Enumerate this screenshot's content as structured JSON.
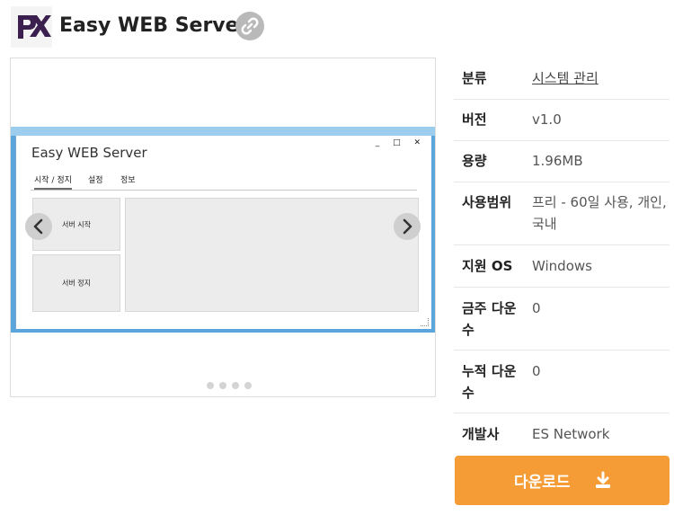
{
  "app": {
    "title": "Easy WEB Server",
    "logo_icon": "px-logo-icon",
    "link_icon": "link-icon",
    "brand_color": "#3b1f4e"
  },
  "carousel": {
    "screenshot": {
      "window_title": "Easy WEB Server",
      "window_controls": "_ □ ✕",
      "tabs": [
        {
          "label": "시작 / 정지",
          "active": true
        },
        {
          "label": "설정",
          "active": false
        },
        {
          "label": "정보",
          "active": false
        }
      ],
      "buttons": {
        "start": "서버 시작",
        "stop": "서버 정지"
      }
    },
    "prev_icon": "chevron-left-icon",
    "next_icon": "chevron-right-icon",
    "page_count": 4
  },
  "info": {
    "category": {
      "label": "분류",
      "value": "시스템 관리"
    },
    "version": {
      "label": "버전",
      "value": "v1.0"
    },
    "size": {
      "label": "용량",
      "value": "1.96MB"
    },
    "license": {
      "label": "사용범위",
      "value": "프리 - 60일 사용, 개인, 국내"
    },
    "os": {
      "label": "지원 OS",
      "value": "Windows"
    },
    "weekly_downloads": {
      "label": "금주 다운수",
      "value": "0"
    },
    "total_downloads": {
      "label": "누적 다운수",
      "value": "0"
    },
    "developer": {
      "label": "개발사",
      "value": "ES Network"
    }
  },
  "download": {
    "label": "다운로드",
    "icon": "download-icon",
    "color": "#f59c36"
  }
}
